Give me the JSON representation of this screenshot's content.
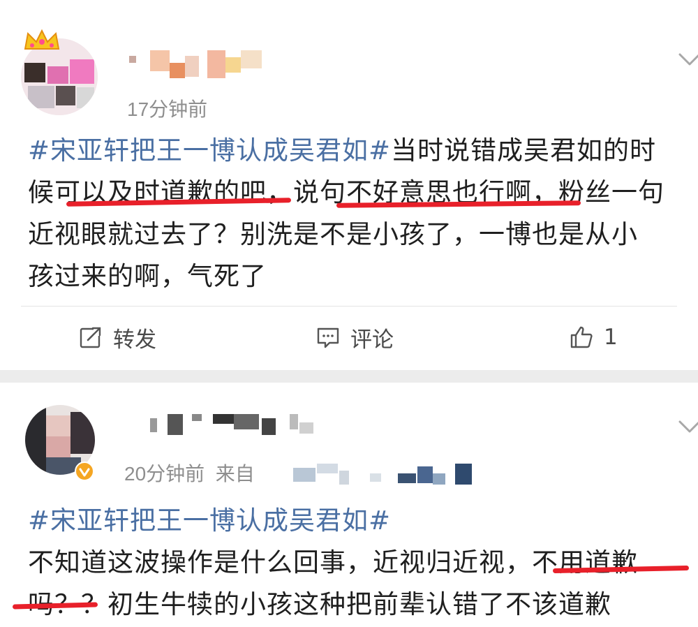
{
  "posts": [
    {
      "time": "17分钟前",
      "hashtag": "#宋亚轩把王一博认成吴君如#",
      "lines": [
        "当时说错成吴君如的时",
        "候可以及时道歉的吧，说句不好意思也行啊，粉丝一句",
        "近视眼就过去了？别洗是不是小孩了，一博也是从小",
        "孩过来的啊，气死了"
      ],
      "actions": {
        "repost": "转发",
        "comment": "评论",
        "like_count": "1"
      }
    },
    {
      "time": "20分钟前",
      "source_prefix": "来自",
      "hashtag": "#宋亚轩把王一博认成吴君如#",
      "lines": [
        "不知道这波操作是什么回事，近视归近视，不用道歉",
        "吗？？初生牛犊的小孩这种把前辈认错了不该道歉"
      ]
    }
  ],
  "icons": {
    "chevron": "chevron-down-icon",
    "repost": "repost-icon",
    "comment": "comment-icon",
    "like": "thumbs-up-icon",
    "verified": "verified-badge-icon",
    "crown": "crown-icon"
  },
  "colors": {
    "hashtag": "#4a6fa3",
    "underline": "#e8202a",
    "verified": "#f5a623"
  }
}
